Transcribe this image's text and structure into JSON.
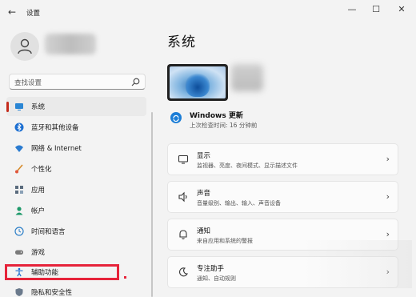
{
  "window": {
    "back_glyph": "←",
    "title": "设置",
    "minimize_glyph": "—",
    "maximize_glyph": "☐",
    "close_glyph": "✕"
  },
  "search": {
    "placeholder": "查找设置"
  },
  "sidebar": {
    "items": [
      {
        "label": "系统",
        "icon": "system-icon",
        "selected": true
      },
      {
        "label": "蓝牙和其他设备",
        "icon": "bluetooth-icon"
      },
      {
        "label": "网络 & Internet",
        "icon": "wifi-icon"
      },
      {
        "label": "个性化",
        "icon": "brush-icon"
      },
      {
        "label": "应用",
        "icon": "apps-icon"
      },
      {
        "label": "帐户",
        "icon": "account-icon"
      },
      {
        "label": "时间和语言",
        "icon": "globe-clock-icon"
      },
      {
        "label": "游戏",
        "icon": "game-icon"
      },
      {
        "label": "辅助功能",
        "icon": "accessibility-icon",
        "highlighted": true
      },
      {
        "label": "隐私和安全性",
        "icon": "shield-icon"
      }
    ]
  },
  "main": {
    "title": "系统",
    "update": {
      "title": "Windows 更新",
      "subtitle": "上次检查时间: 16 分钟前"
    },
    "cards": [
      {
        "title": "显示",
        "desc": "监视器、亮度、夜间模式、显示描述文件",
        "icon": "display-icon"
      },
      {
        "title": "声音",
        "desc": "音量级别、输出、输入、声音设备",
        "icon": "sound-icon"
      },
      {
        "title": "通知",
        "desc": "来自应用和系统的警报",
        "icon": "bell-icon"
      },
      {
        "title": "专注助手",
        "desc": "通知、自动规则",
        "icon": "moon-icon"
      }
    ],
    "chevron": "›"
  },
  "colors": {
    "accent": "#c42b1c",
    "highlight_box": "#e6233a",
    "update_blue": "#1b7dd6"
  }
}
